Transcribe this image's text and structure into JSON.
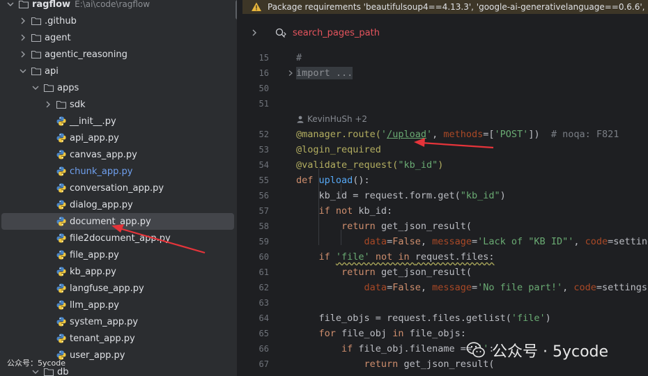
{
  "project_tree": {
    "root": {
      "label": "ragflow",
      "path": "E:\\ai\\code\\ragflow"
    },
    "items": [
      {
        "label": ".github",
        "type": "folder",
        "depth": 1,
        "expanded": false
      },
      {
        "label": "agent",
        "type": "folder",
        "depth": 1,
        "expanded": false
      },
      {
        "label": "agentic_reasoning",
        "type": "folder",
        "depth": 1,
        "expanded": false
      },
      {
        "label": "api",
        "type": "folder",
        "depth": 1,
        "expanded": true
      },
      {
        "label": "apps",
        "type": "folder",
        "depth": 2,
        "expanded": true
      },
      {
        "label": "sdk",
        "type": "folder",
        "depth": 3,
        "expanded": false
      },
      {
        "label": "__init__.py",
        "type": "python",
        "depth": 3
      },
      {
        "label": "api_app.py",
        "type": "python",
        "depth": 3
      },
      {
        "label": "canvas_app.py",
        "type": "python",
        "depth": 3
      },
      {
        "label": "chunk_app.py",
        "type": "python",
        "depth": 3,
        "modified": true
      },
      {
        "label": "conversation_app.py",
        "type": "python",
        "depth": 3
      },
      {
        "label": "dialog_app.py",
        "type": "python",
        "depth": 3
      },
      {
        "label": "document_app.py",
        "type": "python",
        "depth": 3,
        "selected": true
      },
      {
        "label": "file2document_app.py",
        "type": "python",
        "depth": 3
      },
      {
        "label": "file_app.py",
        "type": "python",
        "depth": 3
      },
      {
        "label": "kb_app.py",
        "type": "python",
        "depth": 3
      },
      {
        "label": "langfuse_app.py",
        "type": "python",
        "depth": 3
      },
      {
        "label": "llm_app.py",
        "type": "python",
        "depth": 3
      },
      {
        "label": "system_app.py",
        "type": "python",
        "depth": 3
      },
      {
        "label": "tenant_app.py",
        "type": "python",
        "depth": 3
      },
      {
        "label": "user_app.py",
        "type": "python",
        "depth": 3
      },
      {
        "label": "db",
        "type": "folder",
        "depth": 2,
        "expanded": true
      }
    ]
  },
  "warning_banner": {
    "text": "Package requirements 'beautifulsoup4==4.13.3', 'google-ai-generativelanguage==0.6.6', 'goo"
  },
  "breadcrumb": {
    "label": "search_pages_path"
  },
  "editor": {
    "author_hint": "KevinHuSh +2",
    "lines": [
      {
        "n": "15",
        "tokens": [
          {
            "t": "#",
            "c": "cmt"
          }
        ]
      },
      {
        "n": "16",
        "fold": true,
        "tokens": [
          {
            "t": "import ...",
            "c": "imp"
          }
        ]
      },
      {
        "n": "50",
        "tokens": []
      },
      {
        "n": "51",
        "tokens": []
      },
      {
        "n": "52",
        "tokens": [
          {
            "t": "@manager.route(",
            "c": "dec"
          },
          {
            "t": "'",
            "c": "str"
          },
          {
            "t": "/upload",
            "c": "str uline"
          },
          {
            "t": "'",
            "c": "str"
          },
          {
            "t": ", "
          },
          {
            "t": "methods",
            "c": "param"
          },
          {
            "t": "=["
          },
          {
            "t": "'POST'",
            "c": "str"
          },
          {
            "t": "])  "
          },
          {
            "t": "# noqa: F821",
            "c": "cmt"
          }
        ]
      },
      {
        "n": "53",
        "tokens": [
          {
            "t": "@login_required",
            "c": "dec"
          }
        ]
      },
      {
        "n": "54",
        "tokens": [
          {
            "t": "@validate_request(",
            "c": "dec"
          },
          {
            "t": "\"kb_id\"",
            "c": "str"
          },
          {
            "t": ")",
            "c": "dec"
          }
        ]
      },
      {
        "n": "55",
        "tokens": [
          {
            "t": "def ",
            "c": "kw"
          },
          {
            "t": "upload",
            "c": "fn"
          },
          {
            "t": "():"
          }
        ]
      },
      {
        "n": "56",
        "tokens": [
          {
            "t": "    kb_id = request.form.get("
          },
          {
            "t": "\"kb_id\"",
            "c": "str"
          },
          {
            "t": ")"
          }
        ]
      },
      {
        "n": "57",
        "tokens": [
          {
            "t": "    "
          },
          {
            "t": "if not ",
            "c": "kw"
          },
          {
            "t": "kb_id:"
          }
        ]
      },
      {
        "n": "58",
        "tokens": [
          {
            "t": "        "
          },
          {
            "t": "return ",
            "c": "kw"
          },
          {
            "t": "get_json_result("
          }
        ]
      },
      {
        "n": "59",
        "tokens": [
          {
            "t": "            "
          },
          {
            "t": "data",
            "c": "param"
          },
          {
            "t": "="
          },
          {
            "t": "False",
            "c": "kw"
          },
          {
            "t": ", "
          },
          {
            "t": "message",
            "c": "param"
          },
          {
            "t": "="
          },
          {
            "t": "'Lack of \"KB ID\"'",
            "c": "str"
          },
          {
            "t": ", "
          },
          {
            "t": "code",
            "c": "param"
          },
          {
            "t": "=settings.RE"
          }
        ]
      },
      {
        "n": "60",
        "tokens": [
          {
            "t": "    "
          },
          {
            "t": "if ",
            "c": "kw"
          },
          {
            "t": "'file'",
            "c": "str wavy"
          },
          {
            "t": " not in ",
            "c": "kw wavy"
          },
          {
            "t": "request.files:",
            "c": "wavy"
          }
        ]
      },
      {
        "n": "61",
        "tokens": [
          {
            "t": "        "
          },
          {
            "t": "return ",
            "c": "kw"
          },
          {
            "t": "get_json_result("
          }
        ]
      },
      {
        "n": "62",
        "tokens": [
          {
            "t": "            "
          },
          {
            "t": "data",
            "c": "param"
          },
          {
            "t": "="
          },
          {
            "t": "False",
            "c": "kw"
          },
          {
            "t": ", "
          },
          {
            "t": "message",
            "c": "param"
          },
          {
            "t": "="
          },
          {
            "t": "'No file part!'",
            "c": "str"
          },
          {
            "t": ", "
          },
          {
            "t": "code",
            "c": "param"
          },
          {
            "t": "=settings.RetC"
          }
        ]
      },
      {
        "n": "63",
        "tokens": []
      },
      {
        "n": "64",
        "tokens": [
          {
            "t": "    file_objs = request.files.getlist("
          },
          {
            "t": "'file'",
            "c": "str"
          },
          {
            "t": ")"
          }
        ]
      },
      {
        "n": "65",
        "tokens": [
          {
            "t": "    "
          },
          {
            "t": "for ",
            "c": "kw"
          },
          {
            "t": "file_obj "
          },
          {
            "t": "in ",
            "c": "kw"
          },
          {
            "t": "file_objs:"
          }
        ]
      },
      {
        "n": "66",
        "tokens": [
          {
            "t": "        "
          },
          {
            "t": "if ",
            "c": "kw"
          },
          {
            "t": "file_obj.filename == "
          },
          {
            "t": "''",
            "c": "str"
          },
          {
            "t": ":"
          }
        ]
      },
      {
        "n": "67",
        "tokens": [
          {
            "t": "            "
          },
          {
            "t": "return ",
            "c": "kw"
          },
          {
            "t": "get_json_result("
          }
        ]
      }
    ]
  },
  "watermark": {
    "text": "公众号 · 5ycode",
    "small_text": "公众号：5ycode"
  },
  "colors": {
    "tree_bg": "#2b2d30",
    "editor_bg": "#1e1f22",
    "warning_bg": "#3d3627",
    "selection_bg": "#43454a",
    "keyword": "#cf8e6d",
    "string": "#6aab73",
    "decorator": "#b3ae60",
    "annotation_arrow": "#e5343a"
  },
  "icons": {
    "folder": "folder-icon",
    "python": "python-file-icon",
    "warning": "warning-icon",
    "function": "function-icon",
    "author": "person-icon",
    "wechat": "wechat-icon"
  }
}
